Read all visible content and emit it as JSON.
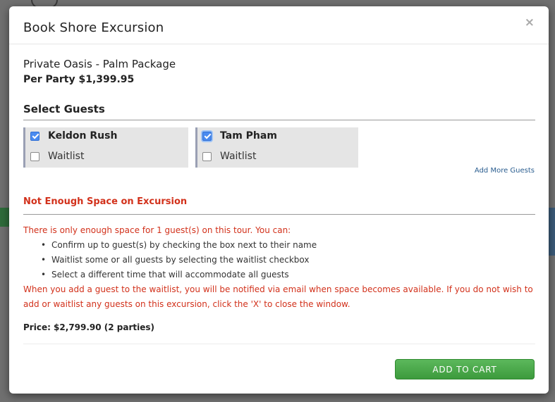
{
  "modal": {
    "title": "Book Shore Excursion",
    "close_label": "×",
    "package_name": "Private Oasis - Palm Package",
    "package_price": "Per Party $1,399.95",
    "select_guests_title": "Select Guests",
    "guests": [
      {
        "name": "Keldon Rush",
        "selected": true,
        "waitlist_label": "Waitlist",
        "waitlist": false
      },
      {
        "name": "Tam Pham",
        "selected": true,
        "waitlist_label": "Waitlist",
        "waitlist": false
      }
    ],
    "add_more_guests": "Add More Guests",
    "warning": {
      "title": "Not Enough Space on Excursion",
      "intro": "There is only enough space for 1 guest(s) on this tour. You can:",
      "options": [
        "Confirm up to guest(s) by checking the box next to their name",
        "Waitlist some or all guests by selecting the waitlist checkbox",
        "Select a different time that will accommodate all guests"
      ],
      "note": "When you add a guest to the waitlist, you will be notified via email when space becomes available. If you do not wish to add or waitlist any guests on this excursion, click the 'X' to close the window."
    },
    "price": "Price: $2,799.90 (2 parties)",
    "add_to_cart": "ADD TO CART"
  },
  "colors": {
    "warning_red": "#d2311b",
    "button_green": "#4cae4c",
    "link_blue": "#2a5d8f",
    "checkbox_blue": "#4a8bf0"
  },
  "icons": {
    "close": "close-icon",
    "checked": "checkbox-checked",
    "unchecked": "checkbox-unchecked"
  }
}
